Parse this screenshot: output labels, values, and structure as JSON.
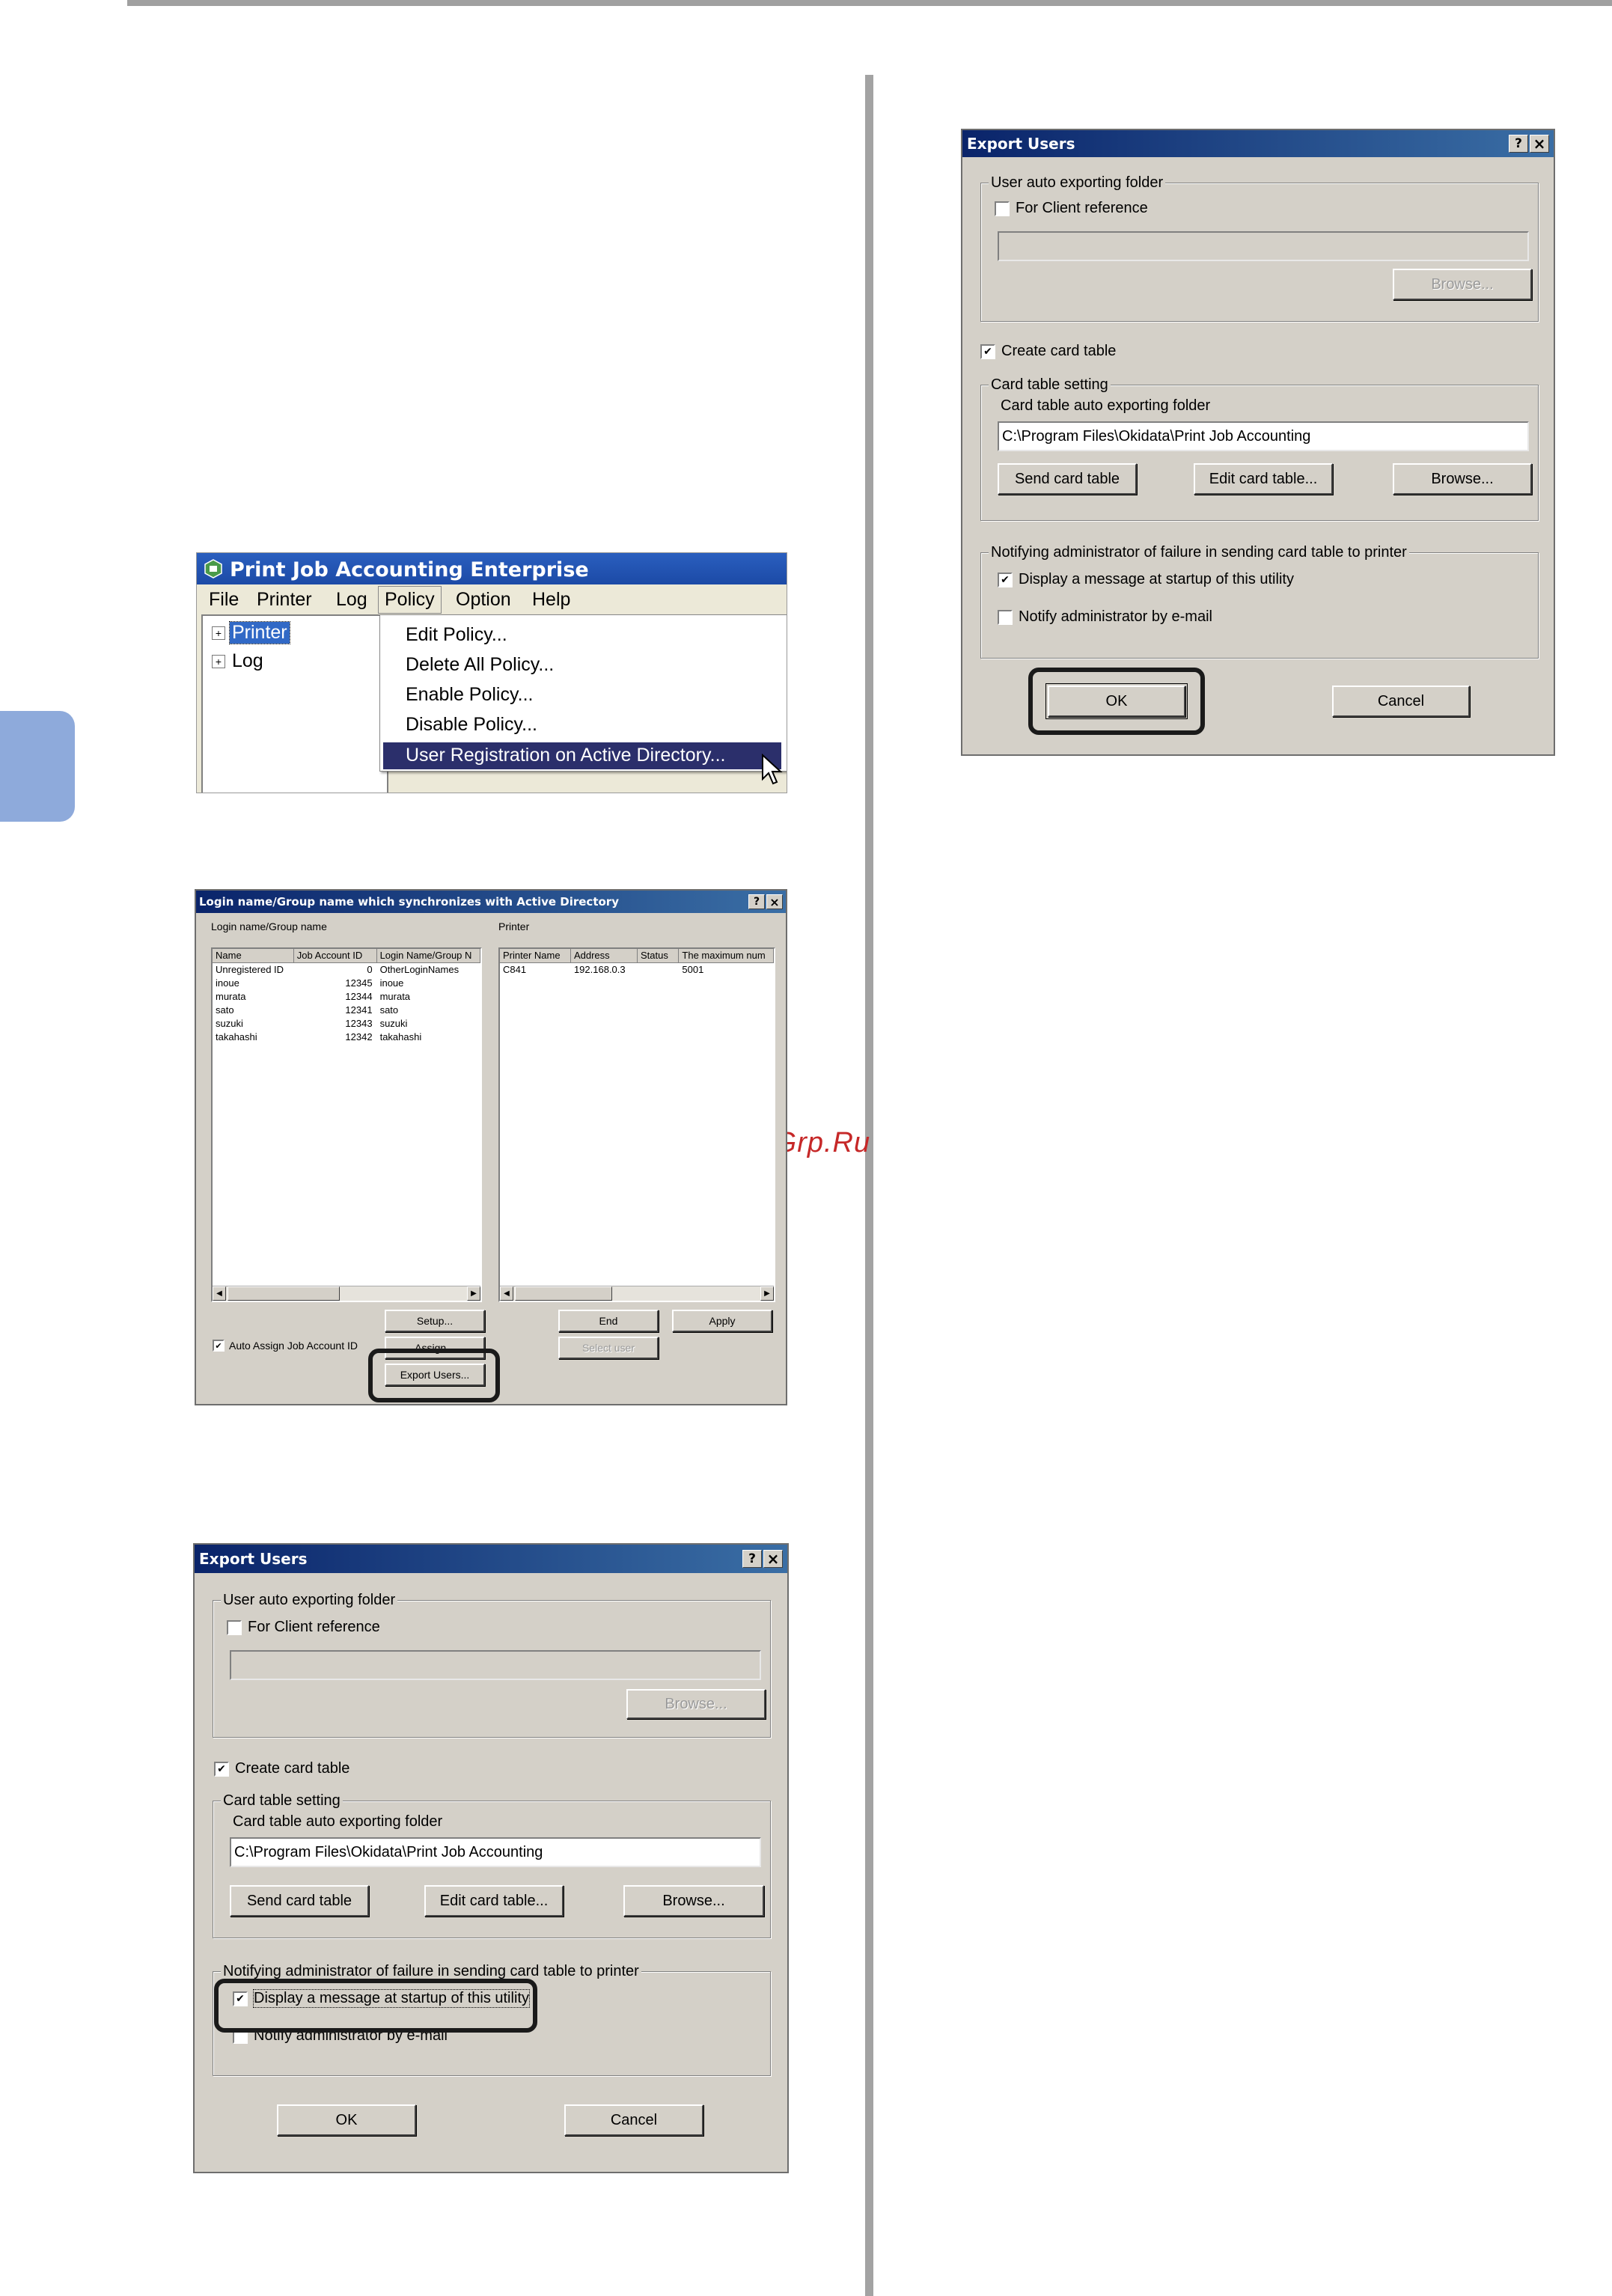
{
  "watermark": "McGrp.Ru",
  "pja": {
    "title": "Print Job Accounting Enterprise",
    "menu": [
      "File",
      "Printer",
      "Log",
      "Policy",
      "Option",
      "Help"
    ],
    "tree": [
      "Printer",
      "Log"
    ],
    "dropdown": [
      "Edit Policy...",
      "Delete All Policy...",
      "Enable Policy...",
      "Disable Policy...",
      "User Registration on Active Directory..."
    ]
  },
  "ad": {
    "title": "Login name/Group name which synchronizes with Active Directory",
    "help": "?",
    "close": "×",
    "left_label": "Login name/Group name",
    "right_label": "Printer",
    "left_cols": [
      "Name",
      "Job Account ID",
      "Login Name/Group N"
    ],
    "left_rows": [
      [
        "Unregistered ID",
        "0",
        "OtherLoginNames"
      ],
      [
        "inoue",
        "12345",
        "inoue"
      ],
      [
        "murata",
        "12344",
        "murata"
      ],
      [
        "sato",
        "12341",
        "sato"
      ],
      [
        "suzuki",
        "12343",
        "suzuki"
      ],
      [
        "takahashi",
        "12342",
        "takahashi"
      ]
    ],
    "right_cols": [
      "Printer Name",
      "Address",
      "Status",
      "The maximum num"
    ],
    "right_rows": [
      [
        "C841",
        "192.168.0.3",
        "",
        "5001"
      ]
    ],
    "setup": "Setup...",
    "assign": "Assign...",
    "export": "Export Users...",
    "auto_assign": "Auto Assign Job Account ID",
    "end": "End",
    "apply": "Apply",
    "select_user": "Select user"
  },
  "exp": {
    "title": "Export Users",
    "help": "?",
    "close": "×",
    "group_user": "User auto exporting folder",
    "for_client": "For Client reference",
    "browse": "Browse...",
    "create_card": "Create card table",
    "group_card": "Card table setting",
    "card_folder_label": "Card table auto exporting folder",
    "card_folder_value": "C:\\Program Files\\Okidata\\Print Job Accounting",
    "send_card": "Send card table",
    "edit_card": "Edit card table...",
    "group_notify": "Notifying administrator of failure in sending card table to printer",
    "display_msg": "Display a message at startup of this utility",
    "notify_email": "Notify administrator by e-mail",
    "ok": "OK",
    "cancel": "Cancel",
    "check": "✔"
  }
}
